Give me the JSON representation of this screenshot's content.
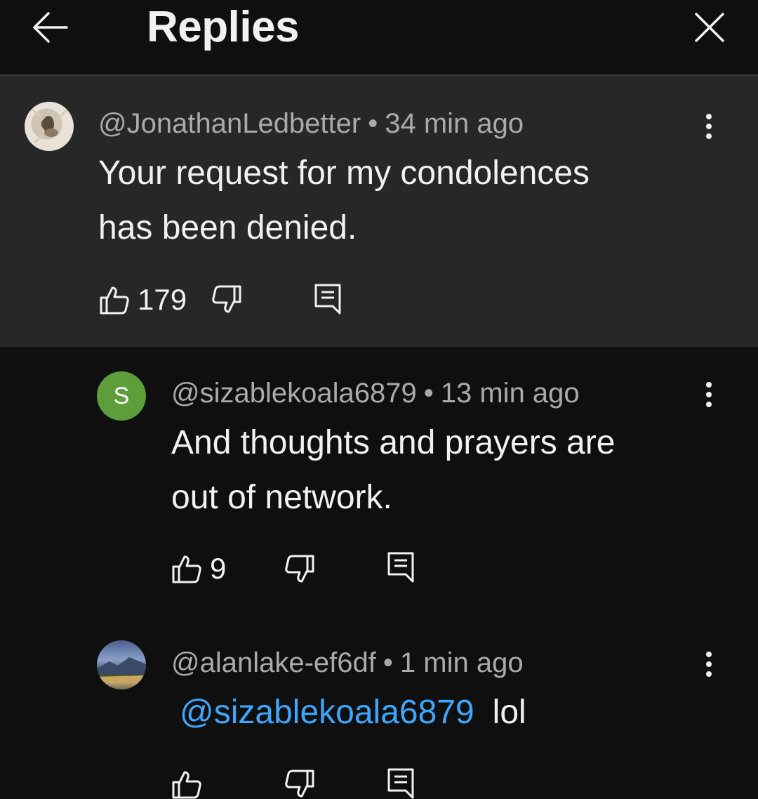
{
  "header": {
    "title": "Replies"
  },
  "comments": [
    {
      "handle": "@JonathanLedbetter",
      "separator": "•",
      "time": "34 min ago",
      "lines": [
        "Your request for my condolences",
        "has been denied."
      ],
      "likes": "179"
    },
    {
      "avatar_letter": "S",
      "avatar_color": "#5e9e3a",
      "handle": "@sizablekoala6879",
      "separator": "•",
      "time": "13 min ago",
      "lines": [
        "And thoughts and prayers are",
        "out of network."
      ],
      "likes": "9"
    },
    {
      "handle": "@alanlake-ef6df",
      "separator": "•",
      "time": "1 min ago",
      "mention": "@sizablekoala6879",
      "text": "lol"
    }
  ],
  "colors": {
    "background": "#0f0f0f",
    "highlight": "#272727",
    "mention": "#3ea6ff",
    "secondary_text": "#aaaaaa"
  },
  "icons": [
    "back-arrow-icon",
    "close-icon",
    "more-vert-icon",
    "thumb-up-icon",
    "thumb-down-icon",
    "reply-icon"
  ]
}
